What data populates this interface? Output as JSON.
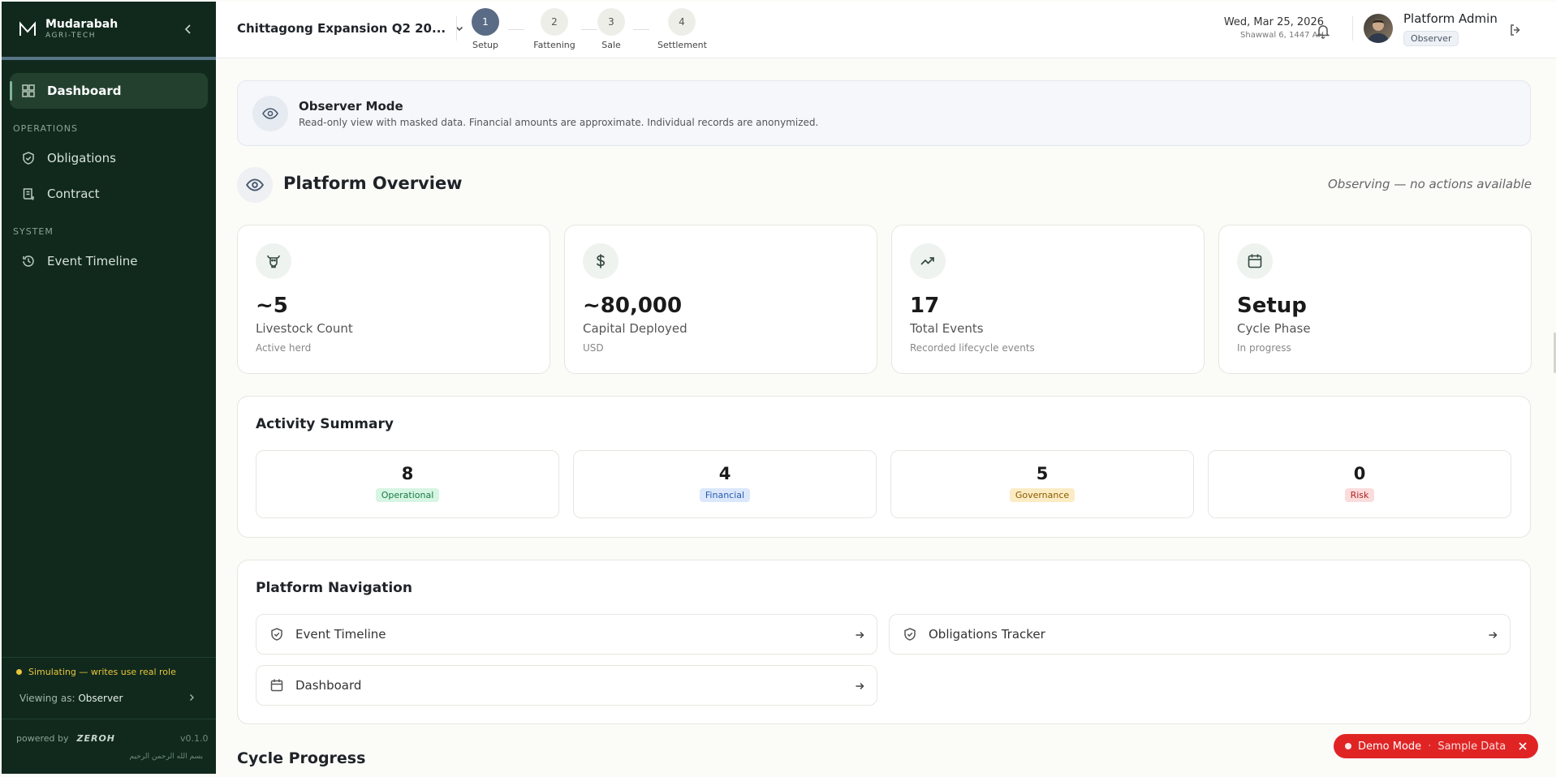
{
  "brand": {
    "name": "Mudarabah",
    "sub": "AGRI-TECH"
  },
  "sidebar": {
    "items": [
      {
        "label": "Dashboard"
      },
      {
        "label": "Obligations"
      },
      {
        "label": "Contract"
      },
      {
        "label": "Event Timeline"
      }
    ],
    "sections": {
      "operations": "OPERATIONS",
      "system": "SYSTEM"
    },
    "simulating": "Simulating — writes use real role",
    "viewing_prefix": "Viewing as:",
    "viewing_role": "Observer",
    "powered_by": "powered by",
    "powered_logo": "ZEROH",
    "version": "v0.1.0",
    "arabic": "بسم الله الرحمن الرحيم"
  },
  "topbar": {
    "cycle": "Chittagong Expansion Q2 20...",
    "steps": [
      {
        "num": "1",
        "label": "Setup"
      },
      {
        "num": "2",
        "label": "Fattening"
      },
      {
        "num": "3",
        "label": "Sale"
      },
      {
        "num": "4",
        "label": "Settlement"
      }
    ],
    "date": "Wed, Mar 25, 2026",
    "hijri": "Shawwal 6, 1447 AH",
    "user_name": "Platform Admin",
    "user_role": "Observer"
  },
  "banner": {
    "title": "Observer Mode",
    "text": "Read-only view with masked data. Financial amounts are approximate. Individual records are anonymized."
  },
  "overview": {
    "title": "Platform Overview",
    "note": "Observing — no actions available"
  },
  "stats": [
    {
      "value": "~5",
      "label": "Livestock Count",
      "sub": "Active herd"
    },
    {
      "value": "~80,000",
      "label": "Capital Deployed",
      "sub": "USD"
    },
    {
      "value": "17",
      "label": "Total Events",
      "sub": "Recorded lifecycle events"
    },
    {
      "value": "Setup",
      "label": "Cycle Phase",
      "sub": "In progress"
    }
  ],
  "activity": {
    "title": "Activity Summary",
    "items": [
      {
        "value": "8",
        "label": "Operational",
        "bg": "#d6f5e3",
        "fg": "#1a7a44"
      },
      {
        "value": "4",
        "label": "Financial",
        "bg": "#dbe7fb",
        "fg": "#2a5cb0"
      },
      {
        "value": "5",
        "label": "Governance",
        "bg": "#fbecc4",
        "fg": "#8a5a00"
      },
      {
        "value": "0",
        "label": "Risk",
        "bg": "#fbdcdc",
        "fg": "#b02222"
      }
    ]
  },
  "navigation": {
    "title": "Platform Navigation",
    "links": [
      {
        "label": "Event Timeline"
      },
      {
        "label": "Obligations Tracker"
      },
      {
        "label": "Dashboard"
      }
    ]
  },
  "cycle_progress": "Cycle Progress",
  "demo": {
    "mode": "Demo Mode",
    "sep": "·",
    "sample": "Sample Data"
  }
}
